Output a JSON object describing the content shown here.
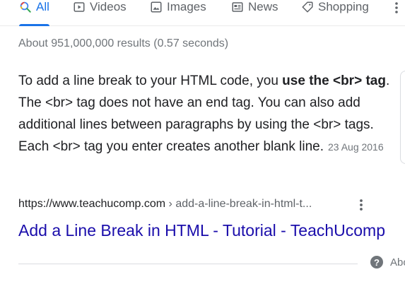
{
  "tabs": [
    {
      "label": "All",
      "icon": "search-icon",
      "active": true
    },
    {
      "label": "Videos",
      "icon": "video-icon"
    },
    {
      "label": "Images",
      "icon": "image-icon"
    },
    {
      "label": "News",
      "icon": "news-icon"
    },
    {
      "label": "Shopping",
      "icon": "tag-icon"
    }
  ],
  "stats": "About 951,000,000 results (0.57 seconds)",
  "snippet": {
    "t1": "To add a line break to your HTML code, you ",
    "b1": "use the <br> tag",
    "t2": ". The <br> tag does not have an end tag. You can also add additional lines between paragraphs by using the <br> tags. Each <br> tag you enter creates another blank line.",
    "date": "23 Aug 2016"
  },
  "result": {
    "site": "https://www.teachucomp.com",
    "path": " › add-a-line-break-in-html-t...",
    "title": "Add a Line Break in HTML - Tutorial - TeachUcomp"
  },
  "about_label": "About",
  "colors": {
    "accent": "#1a73e8",
    "link": "#1a0dab",
    "muted": "#70757a"
  }
}
